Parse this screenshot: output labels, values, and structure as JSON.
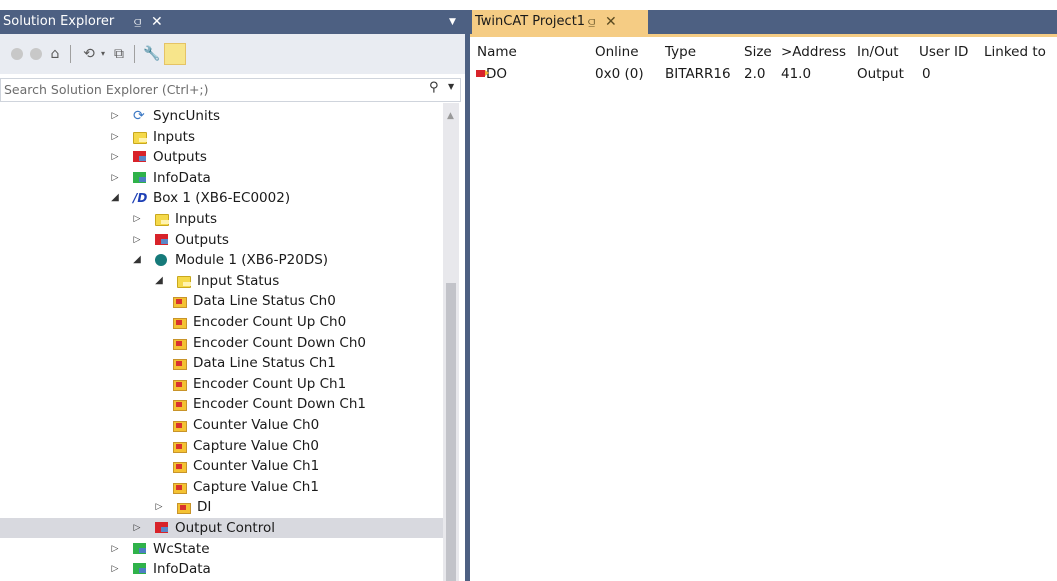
{
  "solution_explorer": {
    "title": "Solution Explorer",
    "pin_glyph": "⫑",
    "close_glyph": "✕",
    "search_placeholder": "Search Solution Explorer (Ctrl+;)"
  },
  "tree": {
    "items": [
      {
        "label": "SyncUnits",
        "icon": "sync-icon",
        "depth": 0,
        "arrow": "collapsed"
      },
      {
        "label": "Inputs",
        "icon": "inputs-folder-icon",
        "depth": 0,
        "arrow": "collapsed"
      },
      {
        "label": "Outputs",
        "icon": "outputs-folder-icon",
        "depth": 0,
        "arrow": "collapsed"
      },
      {
        "label": "InfoData",
        "icon": "infodata-icon",
        "depth": 0,
        "arrow": "collapsed"
      },
      {
        "label": "Box 1 (XB6-EC0002)",
        "icon": "box-icon",
        "depth": 0,
        "arrow": "expanded"
      },
      {
        "label": "Inputs",
        "icon": "inputs-folder-icon",
        "depth": 1,
        "arrow": "collapsed"
      },
      {
        "label": "Outputs",
        "icon": "outputs-folder-icon",
        "depth": 1,
        "arrow": "collapsed"
      },
      {
        "label": "Module 1 (XB6-P20DS)",
        "icon": "module-icon",
        "depth": 1,
        "arrow": "expanded"
      },
      {
        "label": "Input Status",
        "icon": "inputs-folder-icon",
        "depth": 2,
        "arrow": "expanded"
      },
      {
        "label": "Data Line Status Ch0",
        "icon": "variable-icon",
        "depth": 3,
        "arrow": "none"
      },
      {
        "label": "Encoder Count Up Ch0",
        "icon": "variable-icon",
        "depth": 3,
        "arrow": "none"
      },
      {
        "label": "Encoder Count Down Ch0",
        "icon": "variable-icon",
        "depth": 3,
        "arrow": "none"
      },
      {
        "label": "Data Line Status Ch1",
        "icon": "variable-icon",
        "depth": 3,
        "arrow": "none"
      },
      {
        "label": "Encoder Count Up Ch1",
        "icon": "variable-icon",
        "depth": 3,
        "arrow": "none"
      },
      {
        "label": "Encoder Count Down Ch1",
        "icon": "variable-icon",
        "depth": 3,
        "arrow": "none"
      },
      {
        "label": "Counter Value Ch0",
        "icon": "variable-icon",
        "depth": 3,
        "arrow": "none"
      },
      {
        "label": "Capture Value Ch0",
        "icon": "variable-icon",
        "depth": 3,
        "arrow": "none"
      },
      {
        "label": "Counter Value Ch1",
        "icon": "variable-icon",
        "depth": 3,
        "arrow": "none"
      },
      {
        "label": "Capture Value Ch1",
        "icon": "variable-icon",
        "depth": 3,
        "arrow": "none"
      },
      {
        "label": "DI",
        "icon": "variable-icon",
        "depth": 2,
        "arrow": "collapsed"
      },
      {
        "label": "Output Control",
        "icon": "outputs-folder-icon",
        "depth": 1,
        "arrow": "collapsed",
        "selected": true
      },
      {
        "label": "WcState",
        "icon": "wcstate-icon",
        "depth": 0,
        "arrow": "collapsed"
      },
      {
        "label": "InfoData",
        "icon": "infodata-icon",
        "depth": 0,
        "arrow": "collapsed"
      }
    ]
  },
  "document": {
    "tab_title": "TwinCAT Project1",
    "tab_pin": "⫑",
    "tab_close": "✕",
    "columns": [
      "Name",
      "Online",
      "Type",
      "Size",
      ">Address",
      "In/Out",
      "User ID",
      "Linked to"
    ],
    "rows": [
      {
        "name": "DO",
        "online": "0x0 (0)",
        "type": "BITARR16",
        "size": "2.0",
        "address": "41.0",
        "inout": "Output",
        "userid": "0",
        "linked": ""
      }
    ]
  },
  "colors": {
    "title_bar": "#4d6082",
    "active_tab": "#f5cc84",
    "selection": "#d8d9df"
  }
}
